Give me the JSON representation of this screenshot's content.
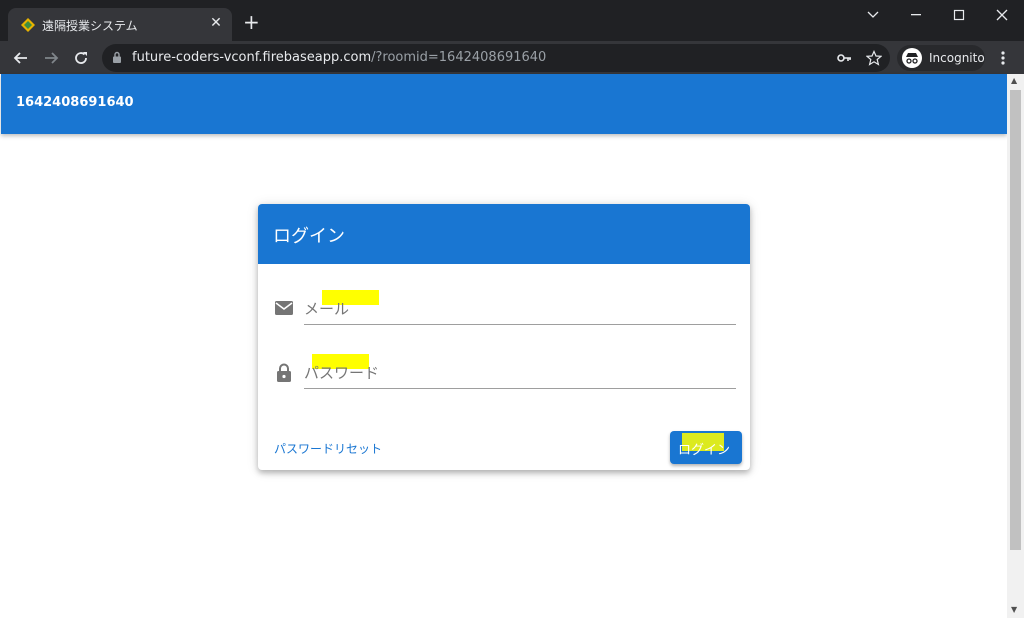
{
  "browser": {
    "tab": {
      "title": "遠隔授業システム",
      "close_icon": "✕"
    },
    "new_tab_icon": "+",
    "window_controls": [
      "chevron-down",
      "minimize",
      "maximize",
      "close"
    ],
    "url": {
      "host": "future-coders-vconf.firebaseapp.com",
      "path": "/?roomid=1642408691640"
    },
    "profile_label": "Incognito"
  },
  "app": {
    "bar_title": "1642408691640"
  },
  "login": {
    "title": "ログイン",
    "email_placeholder": "メール",
    "password_placeholder": "パスワード",
    "reset_link": "パスワードリセット",
    "submit_label": "ログイン"
  },
  "colors": {
    "primary": "#1976d2",
    "highlight": "#ffff00",
    "chrome_dark": "#202124",
    "chrome_toolbar": "#35363a"
  }
}
